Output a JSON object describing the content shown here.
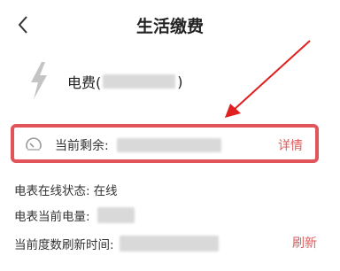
{
  "header": {
    "title": "生活缴费",
    "back_icon": "chevron-left-icon"
  },
  "bill": {
    "name_prefix": "电费(",
    "name_suffix": ")",
    "icon": "lightning-bolt-icon"
  },
  "balance": {
    "label": "当前剩余:",
    "detail_label": "详情",
    "icon": "gauge-icon"
  },
  "status": {
    "online_label": "电表在线状态:",
    "online_value": "在线",
    "power_label": "电表当前电量:",
    "refresh_time_label": "当前度数刷新时间:",
    "refresh_label": "刷新"
  },
  "colors": {
    "accent": "#e05a5a",
    "highlight_border": "#e0545a",
    "arrow": "#e02020"
  }
}
